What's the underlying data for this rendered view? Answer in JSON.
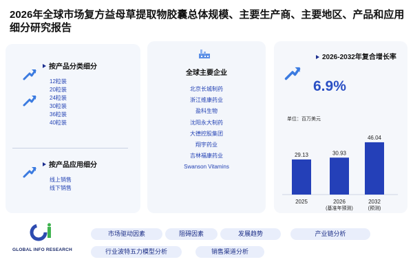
{
  "title": "2026年全球市场复方益母草提取物胶囊总体规模、主要生产商、主要地区、产品和应用细分研究报告",
  "product_section": {
    "heading": "按产品分类细分",
    "items": [
      "12粒装",
      "20粒装",
      "24粒装",
      "30粒装",
      "36粒装",
      "40粒装"
    ]
  },
  "application_section": {
    "heading": "按产品应用细分",
    "items": [
      "线上销售",
      "线下销售"
    ]
  },
  "companies_section": {
    "heading": "全球主要企业",
    "items": [
      "北京长城制药",
      "浙江维康药业",
      "盈科生物",
      "沈阳永大制药",
      "大德控股集团",
      "翔宇药业",
      "吉林福康药业",
      "Swanson Vitamins"
    ]
  },
  "cagr": {
    "label": "2026-2032年复合增长率",
    "value": "6.9%"
  },
  "unit": "单位：百万美元",
  "chart_data": {
    "type": "bar",
    "categories": [
      "2025",
      "2026\n(基准年预测)",
      "2032\n(预测)"
    ],
    "values": [
      29.13,
      30.93,
      46.04
    ],
    "ylim": [
      0,
      50
    ],
    "grid": false,
    "bar_color": "#2440b8"
  },
  "buttons": [
    "市场驱动因素",
    "阻碍因素",
    "发展趋势",
    "产业链分析",
    "行业波特五力模型分析",
    "销售渠道分析"
  ],
  "logo": {
    "text": "GLOBAL INFO RESEARCH"
  },
  "colors": {
    "accent": "#2a4fc4",
    "link": "#2443b4",
    "panel": "#f3f6fb"
  }
}
